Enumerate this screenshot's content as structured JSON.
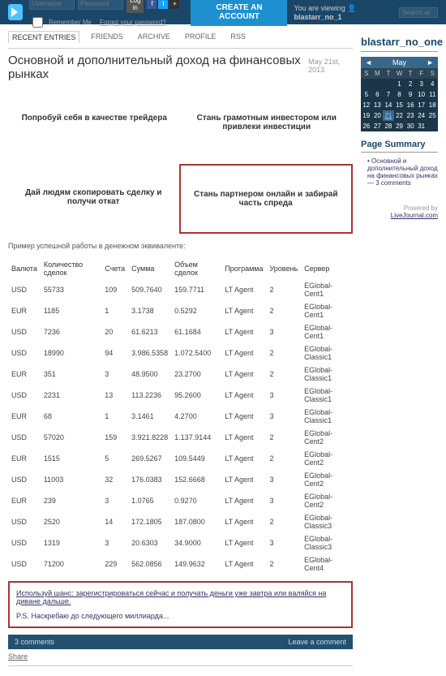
{
  "topbar": {
    "username_ph": "Username",
    "password_ph": "Password",
    "login": "Log in",
    "remember": "Remember Me",
    "forgot": "Forgot your password?",
    "create": "CREATE AN ACCOUNT",
    "viewing_pre": "You are viewing ",
    "viewing_user": "blastarr_no_1",
    "search_ph": "Search at"
  },
  "tabs": [
    "RECENT ENTRIES",
    "FRIENDS",
    "ARCHIVE",
    "PROFILE",
    "RSS"
  ],
  "post": {
    "title": "Основной и дополнительный доход на финансовых рынках",
    "date": "May 21st, 2013",
    "cells": [
      "Попробуй себя в качестве трейдера",
      "Стань грамотным инвестором или привлеки инвестиции",
      "Дай людям скопировать сделку и получи откат",
      "Стань партнером онлайн и забирай часть спреда"
    ],
    "caption": "Пример успешной работы в денежном эквиваленте:",
    "callout1": "Используй шанс: зарегистрироваться сейчас и получать деньги уже завтра или валяйся на диване дальше.",
    "callout2": "P.S. Наскребаю до следующего миллиарда...",
    "comments": "3 comments",
    "leave": "Leave a comment",
    "share": "Share"
  },
  "table": {
    "head": [
      "Валюта",
      "Количество сделок",
      "Счета",
      "Сумма",
      "Объем сделок",
      "Программа",
      "Уровень",
      "Сервер"
    ],
    "rows": [
      [
        "USD",
        "55733",
        "109",
        "509.7640",
        "159.7711",
        "LT Agent",
        "2",
        "EGlobal-Cent1"
      ],
      [
        "EUR",
        "1185",
        "1",
        "3.1738",
        "0.5292",
        "LT Agent",
        "2",
        "EGlobal-Cent1"
      ],
      [
        "USD",
        "7236",
        "20",
        "61.6213",
        "61.1684",
        "LT Agent",
        "3",
        "EGlobal-Cent1"
      ],
      [
        "USD",
        "18990",
        "94",
        "3.986.5358",
        "1.072.5400",
        "LT Agent",
        "2",
        "EGlobal-Classic1"
      ],
      [
        "EUR",
        "351",
        "3",
        "48.9500",
        "23.2700",
        "LT Agent",
        "2",
        "EGlobal-Classic1"
      ],
      [
        "USD",
        "2231",
        "13",
        "113.2236",
        "95.2600",
        "LT Agent",
        "3",
        "EGlobal-Classic1"
      ],
      [
        "EUR",
        "68",
        "1",
        "3.1461",
        "4.2700",
        "LT Agent",
        "3",
        "EGlobal-Classic1"
      ],
      [
        "USD",
        "57020",
        "159",
        "3.921.8228",
        "1.137.9144",
        "LT Agent",
        "2",
        "EGlobal-Cent2"
      ],
      [
        "EUR",
        "1515",
        "5",
        "269.5267",
        "109.5449",
        "LT Agent",
        "2",
        "EGlobal-Cent2"
      ],
      [
        "USD",
        "11003",
        "32",
        "176.0383",
        "152.6668",
        "LT Agent",
        "3",
        "EGlobal-Cent2"
      ],
      [
        "EUR",
        "239",
        "3",
        "1.0765",
        "0.9270",
        "LT Agent",
        "3",
        "EGlobal-Cent2"
      ],
      [
        "USD",
        "2520",
        "14",
        "172.1805",
        "187.0800",
        "LT Agent",
        "2",
        "EGlobal-Classic3"
      ],
      [
        "USD",
        "1319",
        "3",
        "20.6303",
        "34.9000",
        "LT Agent",
        "3",
        "EGlobal-Classic3"
      ],
      [
        "USD",
        "71200",
        "229",
        "562.0856",
        "149.9632",
        "LT Agent",
        "2",
        "EGlobal-Cent4"
      ]
    ]
  },
  "sidebar": {
    "user": "blastarr_no_one",
    "cal": {
      "month": "May",
      "head": [
        "S",
        "M",
        "T",
        "W",
        "T",
        "F",
        "S"
      ],
      "weeks": [
        [
          "",
          "",
          "",
          "1",
          "2",
          "3",
          "4"
        ],
        [
          "5",
          "6",
          "7",
          "8",
          "9",
          "10",
          "11"
        ],
        [
          "12",
          "13",
          "14",
          "15",
          "16",
          "17",
          "18"
        ],
        [
          "19",
          "20",
          "21",
          "22",
          "23",
          "24",
          "25"
        ],
        [
          "26",
          "27",
          "28",
          "29",
          "30",
          "31",
          ""
        ]
      ],
      "today": "21"
    },
    "ps_title": "Page Summary",
    "ps_item": "Основной и дополнительный доход на финансовых рынках",
    "ps_tail": " — 3 comments",
    "powered": "Powered by ",
    "powered_link": "LiveJournal.com"
  }
}
